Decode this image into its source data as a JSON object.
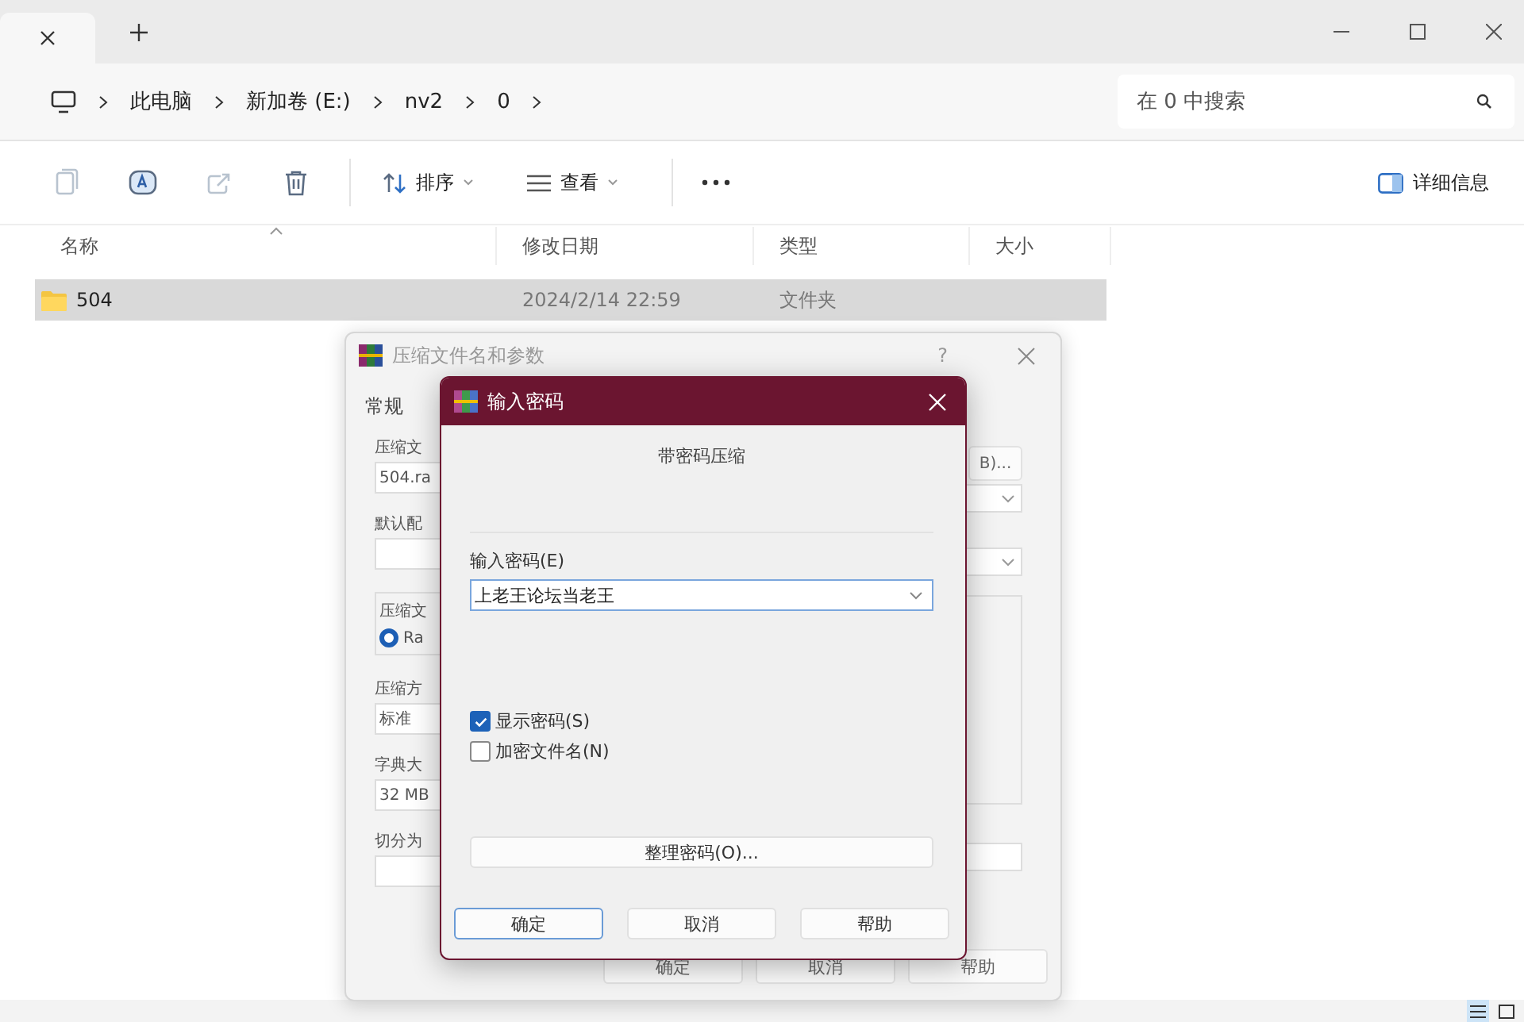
{
  "breadcrumb": [
    "此电脑",
    "新加卷 (E:)",
    "nv2",
    "0"
  ],
  "search": {
    "placeholder": "在 0 中搜索"
  },
  "toolbar": {
    "icons": [
      {
        "kind": "copy",
        "disabled": true
      },
      {
        "kind": "rename",
        "disabled": false
      },
      {
        "kind": "share",
        "disabled": true
      },
      {
        "kind": "delete",
        "disabled": false
      }
    ],
    "sort": "排序",
    "view": "查看",
    "details": "详细信息"
  },
  "table": {
    "columns": [
      "名称",
      "修改日期",
      "类型",
      "大小"
    ],
    "rows": [
      {
        "name": "504",
        "modified": "2024/2/14 22:59",
        "type": "文件夹",
        "selected": true
      }
    ]
  },
  "status_bar": {
    "views": [
      {
        "kind": "details",
        "selected": true
      },
      {
        "kind": "tiles",
        "selected": false
      }
    ]
  },
  "archive_dialog": {
    "title": "压缩文件名和参数",
    "help": "?",
    "tab": "常规",
    "archive_name_label": "压缩文",
    "archive_name": "504.ra",
    "browse": "B)...",
    "profile_label": "默认配",
    "format_group": "压缩文",
    "format_option": {
      "label": "Ra",
      "selected": true
    },
    "method_label": "压缩方",
    "method": "标准",
    "dictionary_label": "字典大",
    "dictionary": "32 MB",
    "split_label": "切分为",
    "buttons": [
      "确定",
      "取消",
      "帮助"
    ]
  },
  "password_dialog": {
    "title": "输入密码",
    "heading": "带密码压缩",
    "password_label": "输入密码(E)",
    "password": "上老王论坛当老王",
    "checkboxes": [
      {
        "label": "显示密码(S)",
        "checked": true
      },
      {
        "label": "加密文件名(N)",
        "checked": false
      }
    ],
    "organize": "整理密码(O)...",
    "buttons": [
      {
        "label": "确定",
        "default": true
      },
      {
        "label": "取消",
        "default": false
      },
      {
        "label": "帮助",
        "default": false
      }
    ]
  }
}
